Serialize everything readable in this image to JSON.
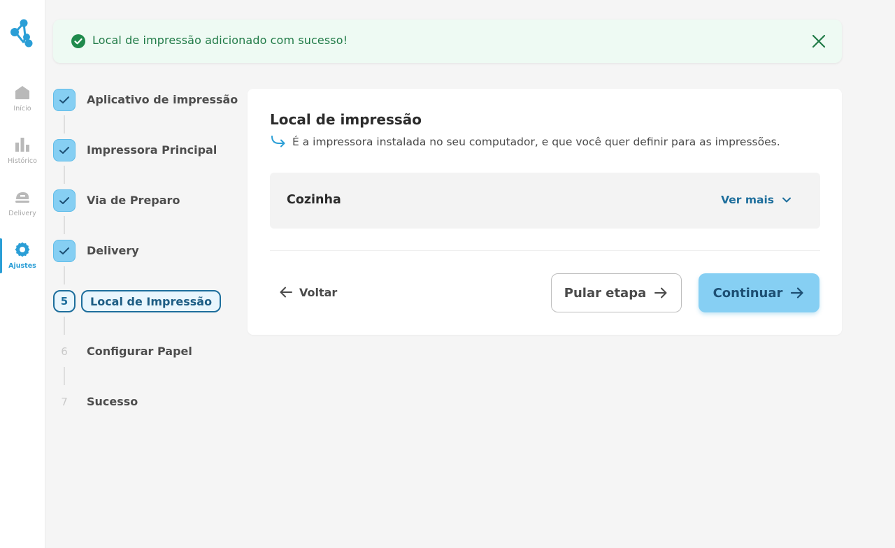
{
  "colors": {
    "accent": "#2a9ed6",
    "accent_light": "#86cff3",
    "accent_dark": "#1d6e9c",
    "success_bg": "#eefaf3",
    "success_text": "#1f7a46",
    "background": "#f5f5f5"
  },
  "sidebar": {
    "logo_icon": "share-network-icon",
    "items": [
      {
        "label": "Início",
        "icon": "home-icon",
        "active": false
      },
      {
        "label": "Histórico",
        "icon": "bar-chart-icon",
        "active": false
      },
      {
        "label": "Delivery",
        "icon": "delivery-scooter-icon",
        "active": false
      },
      {
        "label": "Ajustes",
        "icon": "gear-icon",
        "active": true
      }
    ]
  },
  "toast": {
    "message": "Local de impressão adicionado com sucesso!",
    "icon": "check-circle-icon",
    "close_icon": "close-icon"
  },
  "stepper": {
    "steps": [
      {
        "number": "1",
        "label": "Aplicativo de impressão",
        "status": "done"
      },
      {
        "number": "2",
        "label": "Impressora Principal",
        "status": "done"
      },
      {
        "number": "3",
        "label": "Via de Preparo",
        "status": "done"
      },
      {
        "number": "4",
        "label": "Delivery",
        "status": "done"
      },
      {
        "number": "5",
        "label": "Local de Impressão",
        "status": "current"
      },
      {
        "number": "6",
        "label": "Configurar Papel",
        "status": "pending"
      },
      {
        "number": "7",
        "label": "Sucesso",
        "status": "pending"
      }
    ]
  },
  "card": {
    "title": "Local de impressão",
    "subtitle": "É a impressora instalada no seu computador, e que você quer definir para as impressões.",
    "printer": {
      "name": "Cozinha",
      "expand_label": "Ver mais"
    },
    "actions": {
      "back_label": "Voltar",
      "skip_label": "Pular etapa",
      "continue_label": "Continuar"
    }
  }
}
